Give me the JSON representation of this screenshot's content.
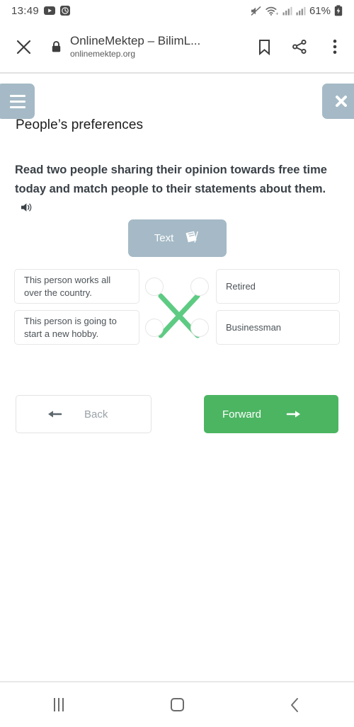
{
  "status_bar": {
    "time": "13:49",
    "notification_icons": [
      "youtube-icon",
      "clock-icon"
    ],
    "mute_icon": "mute-icon",
    "wifi_icon": "wifi-icon",
    "signal_icons": [
      "signal-bars-icon",
      "signal-bars-icon"
    ],
    "battery_percent": "61%",
    "battery_icon": "battery-charging-icon"
  },
  "browser": {
    "close_icon": "close-icon",
    "lock_icon": "lock-icon",
    "title": "OnlineMektep – BilimL...",
    "url": "onlinemektep.org",
    "bookmark_icon": "bookmark-icon",
    "share_icon": "share-icon",
    "menu_icon": "more-vertical-icon"
  },
  "page": {
    "menu_button_label": "menu",
    "close_button_label": "close",
    "title": "People’s preferences",
    "instruction": "Read two people sharing their opinion towards free time today and match people to their statements about them.",
    "audio_icon": "speaker-icon",
    "text_button": {
      "label": "Text",
      "icon": "book-icon"
    },
    "matching": {
      "left_items": [
        "This person works all over the country.",
        "This person is going to start a new hobby."
      ],
      "right_items": [
        "Retired",
        "Businessman"
      ],
      "connection_color": "#5ecb83",
      "connections": [
        {
          "from": "left-1",
          "to": "right-2"
        },
        {
          "from": "left-2",
          "to": "right-1"
        }
      ]
    },
    "back_button": {
      "label": "Back",
      "icon": "arrow-left-icon"
    },
    "forward_button": {
      "label": "Forward",
      "icon": "arrow-right-icon",
      "color": "#4cb562"
    }
  },
  "android_nav": {
    "recents_icon": "recents-icon",
    "home_icon": "home-icon",
    "back_icon": "back-chevron-icon"
  }
}
